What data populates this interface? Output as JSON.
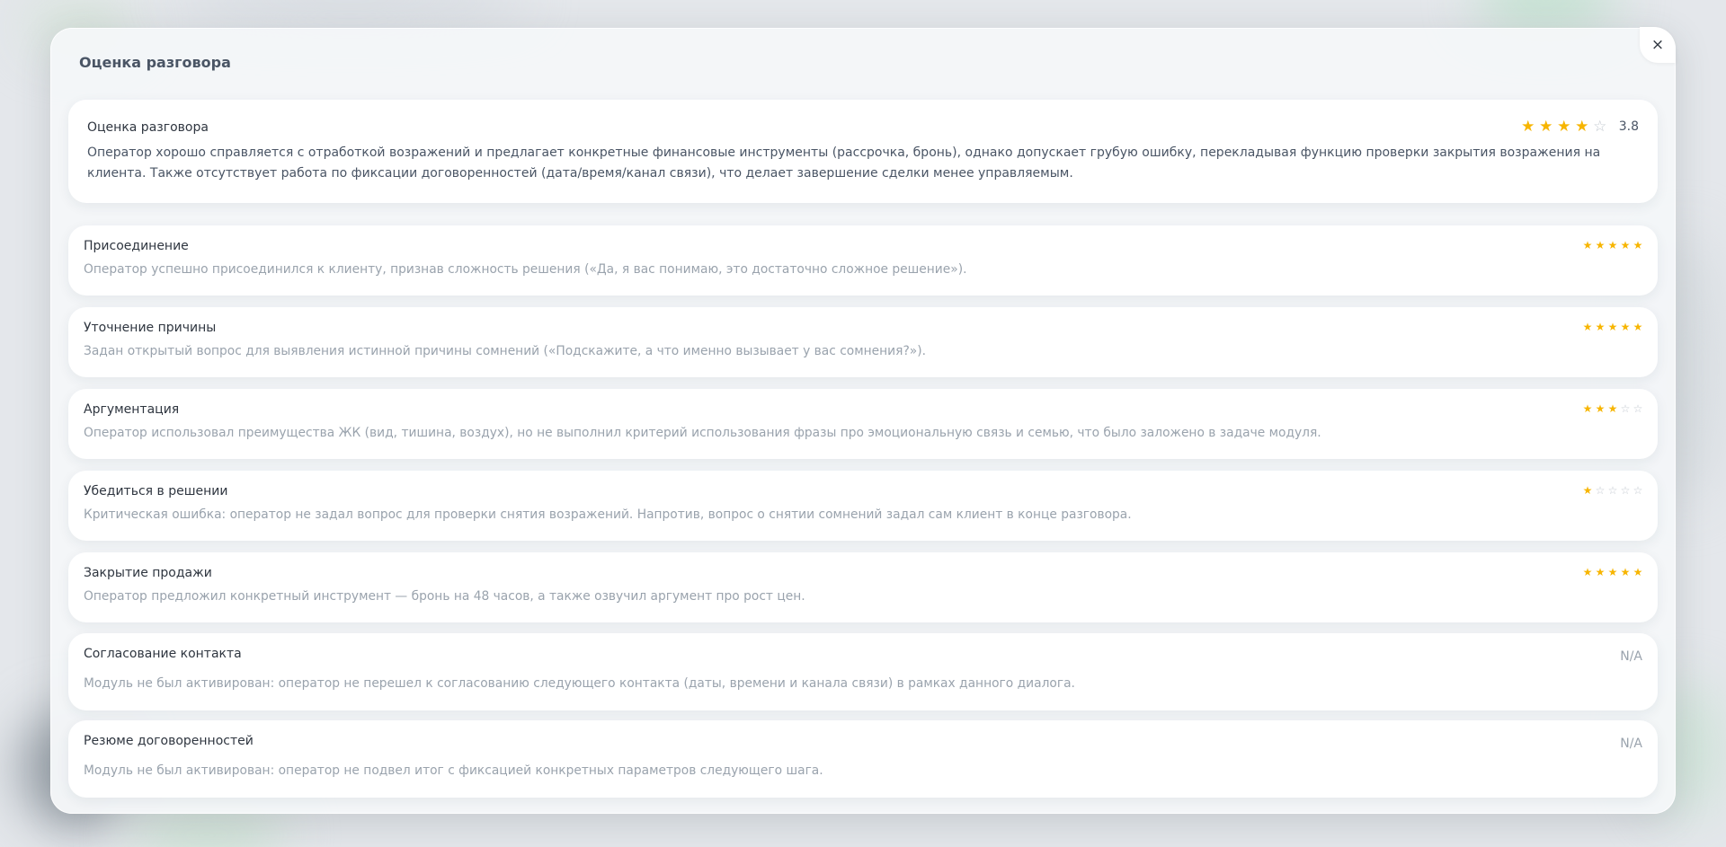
{
  "modal": {
    "title": "Оценка разговора",
    "close_label": "×"
  },
  "summary": {
    "title": "Оценка разговора",
    "score": "3.8",
    "stars_filled": 4,
    "stars_total": 5,
    "text": "Оператор хорошо справляется с отработкой возражений и предлагает конкретные финансовые инструменты (рассрочка, бронь), однако допускает грубую ошибку, перекладывая функцию проверки закрытия возражения на клиента. Также отсутствует работа по фиксации договоренностей (дата/время/канал связи), что делает завершение сделки менее управляемым."
  },
  "sections": [
    {
      "title": "Присоединение",
      "stars": 5,
      "description": "Оператор успешно присоединился к клиенту, признав сложность решения («Да, я вас понимаю, это достаточно сложное решение»)."
    },
    {
      "title": "Уточнение причины",
      "stars": 5,
      "description": "Задан открытый вопрос для выявления истинной причины сомнений («Подскажите, а что именно вызывает у вас сомнения?»)."
    },
    {
      "title": "Аргументация",
      "stars": 3,
      "description": "Оператор использовал преимущества ЖК (вид, тишина, воздух), но не выполнил критерий использования фразы про эмоциональную связь и семью, что было заложено в задаче модуля."
    },
    {
      "title": "Убедиться в решении",
      "stars": 1,
      "description": "Критическая ошибка: оператор не задал вопрос для проверки снятия возражений. Напротив, вопрос о снятии сомнений задал сам клиент в конце разговора."
    },
    {
      "title": "Закрытие продажи",
      "stars": 5,
      "description": "Оператор предложил конкретный инструмент — бронь на 48 часов, а также озвучил аргумент про рост цен."
    },
    {
      "title": "Согласование контакта",
      "na": "N/A",
      "description": "Модуль не был активирован: оператор не перешел к согласованию следующего контакта (даты, времени и канала связи) в рамках данного диалога."
    },
    {
      "title": "Резюме договоренностей",
      "na": "N/A",
      "description": "Модуль не был активирован: оператор не подвел итог с фиксацией конкретных параметров следующего шага."
    }
  ],
  "colors": {
    "star_filled": "#f7b500",
    "star_empty": "#c2c8cf",
    "title_text": "#2f3640",
    "muted_text": "#9aa3ad"
  },
  "icons": {
    "star": "star-icon",
    "close": "close-icon"
  }
}
